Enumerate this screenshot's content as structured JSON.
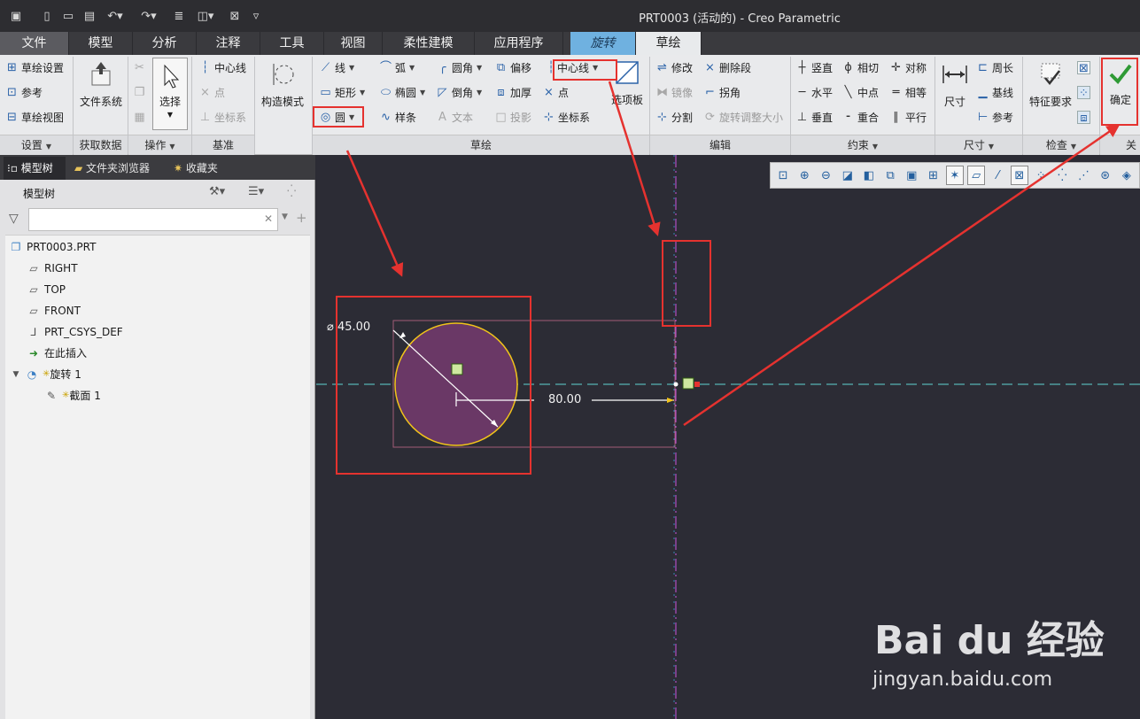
{
  "app": {
    "title": "PRT0003 (活动的) - Creo Parametric"
  },
  "quick_access": [
    "app-icon",
    "new-icon",
    "open-icon",
    "save-icon",
    "undo-icon",
    "redo-icon",
    "regenerate-icon",
    "window-icon",
    "close-icon",
    "customize-icon"
  ],
  "tabs": [
    "文件",
    "模型",
    "分析",
    "注释",
    "工具",
    "视图",
    "柔性建模",
    "应用程序",
    "旋转",
    "草绘"
  ],
  "ribbon": {
    "settings": {
      "items": [
        "草绘设置",
        "参考",
        "草绘视图"
      ],
      "group": "设置"
    },
    "get_data": {
      "file_system": "文件系统",
      "group": "获取数据"
    },
    "operations": {
      "select": "选择",
      "group": "操作"
    },
    "datum": {
      "centerline": "中心线",
      "point": "点",
      "csys": "坐标系",
      "group": "基准"
    },
    "construction_mode": "构造模式",
    "sketch": {
      "line": "线",
      "arc": "弧",
      "fillet": "圆角",
      "offset": "偏移",
      "centerline": "中心线",
      "rectangle": "矩形",
      "ellipse": "椭圆",
      "chamfer": "倒角",
      "thicken": "加厚",
      "point": "点",
      "circle": "圆",
      "spline": "样条",
      "text": "文本",
      "project": "投影",
      "csys": "坐标系",
      "palette": "选项板",
      "group": "草绘"
    },
    "edit": {
      "modify": "修改",
      "delete_segment": "删除段",
      "mirror": "镜像",
      "corner": "拐角",
      "divide": "分割",
      "rotate_resize": "旋转调整大小",
      "group": "编辑"
    },
    "constrain": {
      "vertical": "竖直",
      "tangent": "相切",
      "symmetric": "对称",
      "horizontal": "水平",
      "midpoint": "中点",
      "equal": "相等",
      "perpendicular": "垂直",
      "coincident": "重合",
      "parallel": "平行",
      "group": "约束"
    },
    "dimension": {
      "dimension": "尺寸",
      "perimeter": "周长",
      "baseline": "基线",
      "reference": "参考",
      "group": "尺寸"
    },
    "inspect": {
      "feature_requirements": "特征要求",
      "group": "检查"
    },
    "close": {
      "ok": "确定",
      "group": "关"
    }
  },
  "left_panel": {
    "tabs": [
      "模型树",
      "文件夹浏览器",
      "收藏夹"
    ],
    "tree_title": "模型树",
    "search_placeholder": "",
    "nodes": [
      "PRT0003.PRT",
      "RIGHT",
      "TOP",
      "FRONT",
      "PRT_CSYS_DEF",
      "在此插入",
      "旋转 1",
      "截面 1"
    ]
  },
  "sketch": {
    "diameter_label": "⌀ 45.00",
    "distance_label": "80.00",
    "colors": {
      "circle_fill": "#6a3866",
      "circle_stroke": "#f2c41a",
      "horizontal_centerline": "#5fd4d4",
      "vertical_centerline": "#cc55dd",
      "annotation": "#e5322f"
    }
  },
  "watermark": {
    "brand": "Bai du 经验",
    "url": "jingyan.baidu.com"
  }
}
